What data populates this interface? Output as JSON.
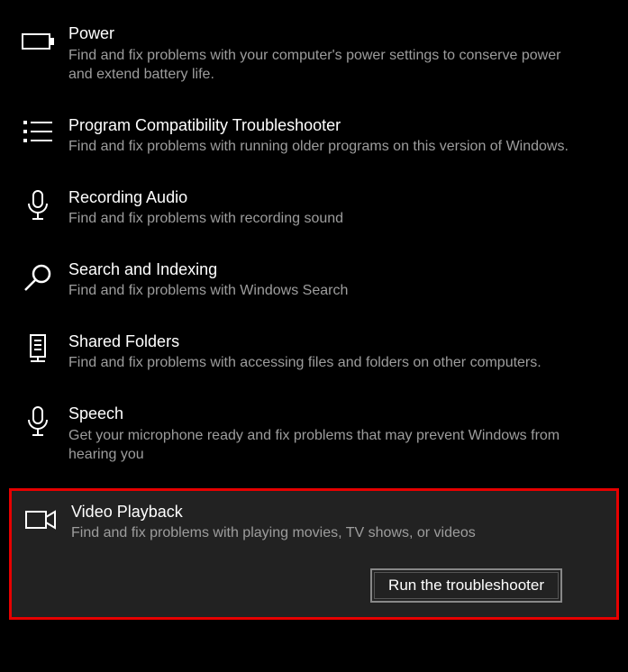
{
  "troubleshooters": [
    {
      "id": "power",
      "title": "Power",
      "desc": "Find and fix problems with your computer's power settings to conserve power and extend battery life.",
      "icon": "battery-icon",
      "selected": false
    },
    {
      "id": "program-compat",
      "title": "Program Compatibility Troubleshooter",
      "desc": "Find and fix problems with running older programs on this version of Windows.",
      "icon": "list-icon",
      "selected": false
    },
    {
      "id": "recording-audio",
      "title": "Recording Audio",
      "desc": "Find and fix problems with recording sound",
      "icon": "microphone-icon",
      "selected": false
    },
    {
      "id": "search-indexing",
      "title": "Search and Indexing",
      "desc": "Find and fix problems with Windows Search",
      "icon": "search-icon",
      "selected": false
    },
    {
      "id": "shared-folders",
      "title": "Shared Folders",
      "desc": "Find and fix problems with accessing files and folders on other computers.",
      "icon": "server-icon",
      "selected": false
    },
    {
      "id": "speech",
      "title": "Speech",
      "desc": "Get your microphone ready and fix problems that may prevent Windows from hearing you",
      "icon": "microphone-icon",
      "selected": false
    },
    {
      "id": "video-playback",
      "title": "Video Playback",
      "desc": "Find and fix problems with playing movies, TV shows, or videos",
      "icon": "video-icon",
      "selected": true
    }
  ],
  "buttons": {
    "run": "Run the troubleshooter"
  }
}
